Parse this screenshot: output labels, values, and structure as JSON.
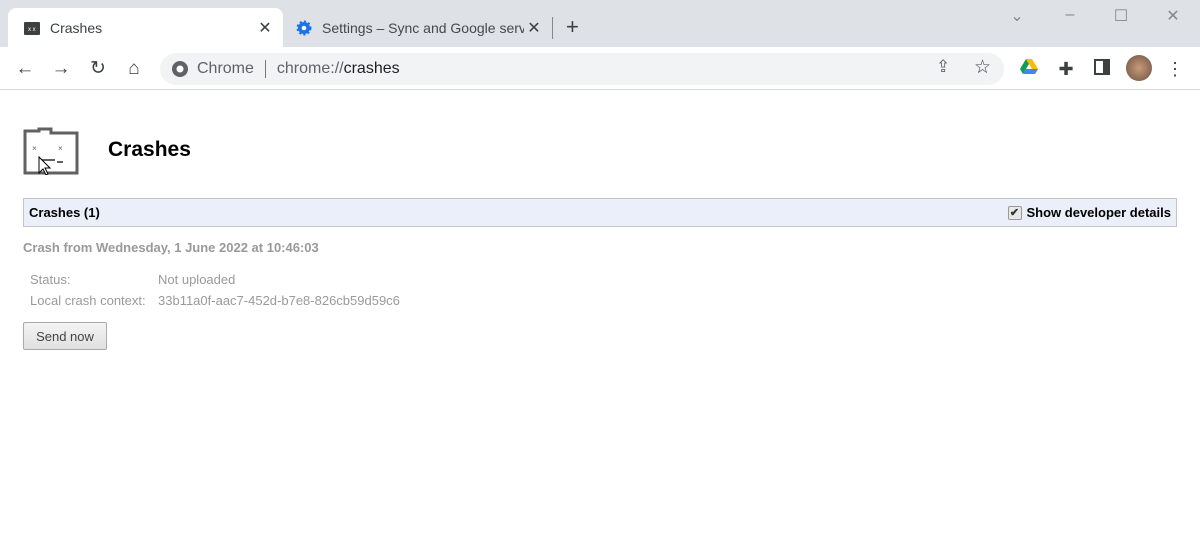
{
  "tabs": [
    {
      "label": "Crashes",
      "active": true
    },
    {
      "label": "Settings – Sync and Google servi"
    }
  ],
  "omnibox": {
    "site": "Chrome",
    "url_prefix": "chrome://",
    "url_host": "crashes"
  },
  "page": {
    "title": "Crashes",
    "section_header": "Crashes (1)",
    "developer_details_label": "Show developer details",
    "developer_details_checked": true,
    "crash": {
      "title": "Crash from Wednesday, 1 June 2022 at 10:46:03",
      "status_label": "Status:",
      "status_value": "Not uploaded",
      "context_label": "Local crash context:",
      "context_value": "33b11a0f-aac7-452d-b7e8-826cb59d59c6"
    },
    "send_button": "Send now"
  },
  "colors": {
    "accent": "#1a73e8",
    "header_bg": "#ebeff9"
  }
}
